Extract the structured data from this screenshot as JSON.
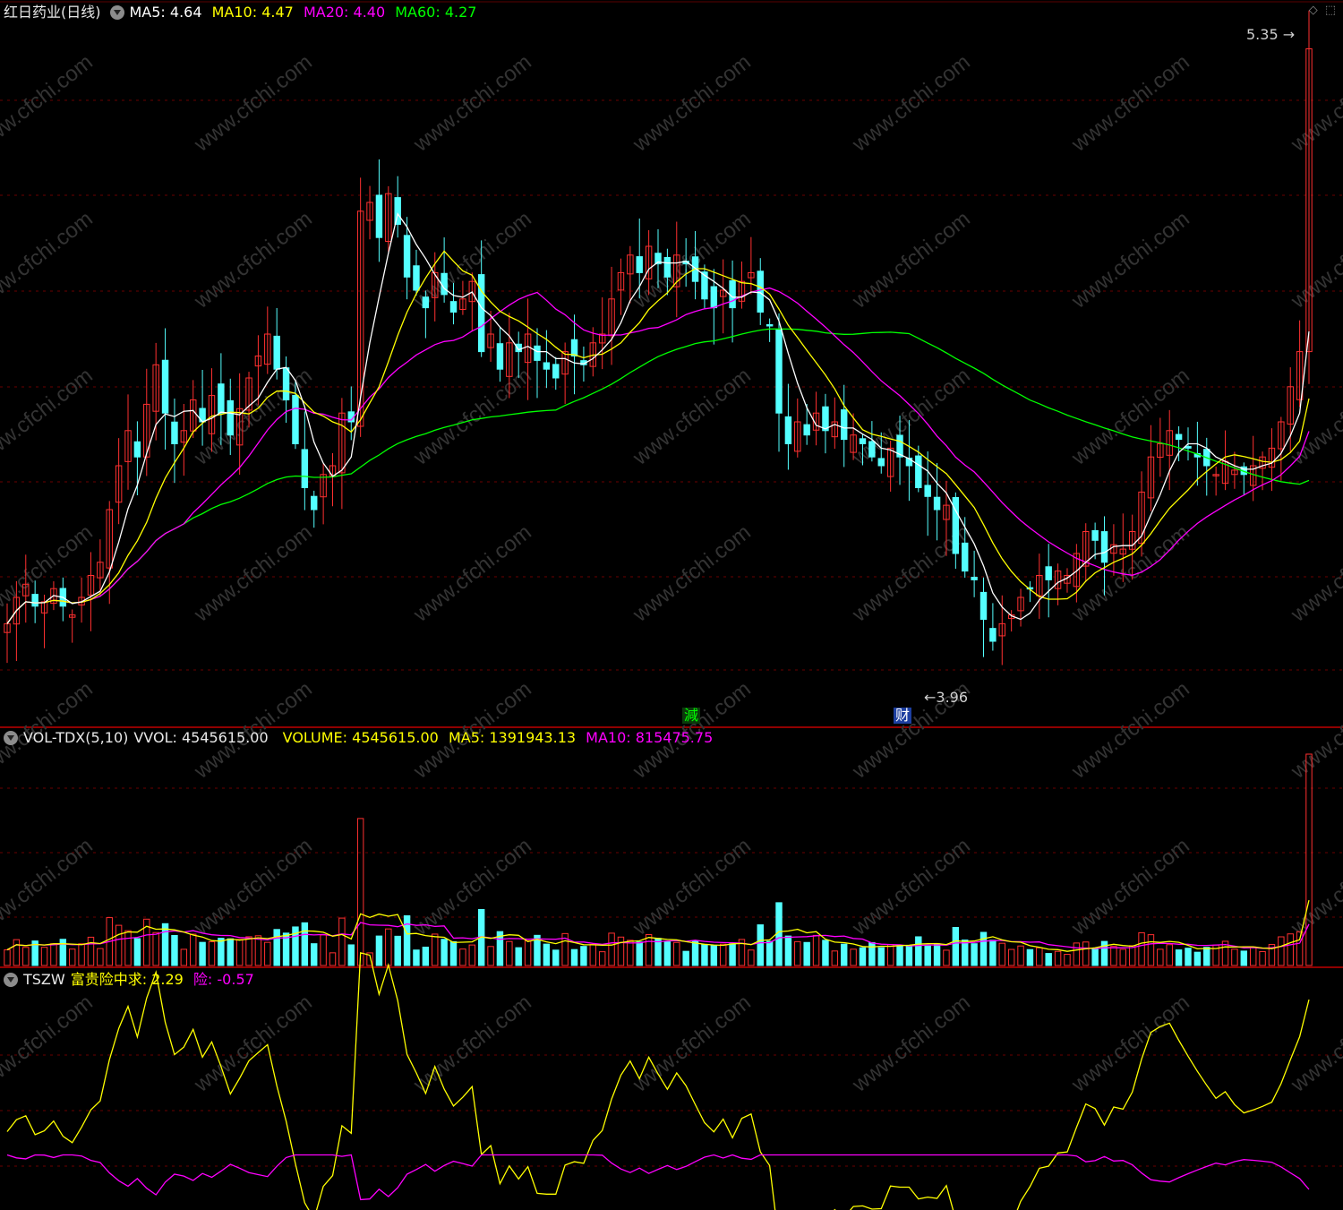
{
  "main_header": {
    "stock_title": "红日药业(日线)",
    "ma5": "MA5: 4.64",
    "ma10": "MA10: 4.47",
    "ma20": "MA20: 4.40",
    "ma60": "MA60: 4.27"
  },
  "vol_header": {
    "indicator": "VOL-TDX(5,10)",
    "vvol": "VVOL: 4545615.00",
    "volume": "VOLUME: 4545615.00",
    "ma5": "MA5: 1391943.13",
    "ma10": "MA10: 815475.75"
  },
  "tszw_header": {
    "indicator": "TSZW",
    "line1": "富贵险中求: 2.29",
    "line2": "险: -0.57"
  },
  "annotations": {
    "high_price": "5.35",
    "low_price": "3.96",
    "marker1": "減",
    "marker2": "财"
  },
  "watermark": "www.cfchi.com",
  "colors": {
    "up": "#ff3030",
    "down": "#54ffff",
    "ma5": "#ffffff",
    "ma10": "#ffff00",
    "ma20": "#ff00ff",
    "ma60": "#00ff00",
    "grid": "#6a0000",
    "divider": "#c00000"
  },
  "chart_data": {
    "type": "candlestick",
    "price_range": [
      3.9,
      5.4
    ],
    "close_series": [
      4.04,
      4.1,
      4.13,
      4.08,
      4.09,
      4.12,
      4.08,
      4.06,
      4.1,
      4.15,
      4.18,
      4.3,
      4.4,
      4.48,
      4.42,
      4.54,
      4.63,
      4.52,
      4.45,
      4.48,
      4.55,
      4.5,
      4.56,
      4.52,
      4.47,
      4.53,
      4.6,
      4.65,
      4.7,
      4.62,
      4.55,
      4.45,
      4.35,
      4.3,
      4.38,
      4.4,
      4.52,
      4.5,
      4.98,
      5.0,
      4.92,
      5.02,
      4.95,
      4.83,
      4.8,
      4.76,
      4.84,
      4.79,
      4.75,
      4.78,
      4.82,
      4.66,
      4.7,
      4.62,
      4.68,
      4.66,
      4.7,
      4.64,
      4.62,
      4.6,
      4.66,
      4.65,
      4.63,
      4.68,
      4.7,
      4.78,
      4.84,
      4.88,
      4.84,
      4.9,
      4.86,
      4.83,
      4.88,
      4.86,
      4.82,
      4.78,
      4.76,
      4.8,
      4.76,
      4.82,
      4.84,
      4.75,
      4.72,
      4.52,
      4.45,
      4.5,
      4.47,
      4.52,
      4.48,
      4.5,
      4.46,
      4.47,
      4.45,
      4.42,
      4.4,
      4.44,
      4.42,
      4.4,
      4.35,
      4.33,
      4.3,
      4.31,
      4.2,
      4.16,
      4.14,
      4.05,
      4.0,
      4.04,
      4.06,
      4.1,
      4.12,
      4.15,
      4.14,
      4.16,
      4.15,
      4.2,
      4.25,
      4.23,
      4.18,
      4.22,
      4.21,
      4.25,
      4.34,
      4.42,
      4.45,
      4.48,
      4.46,
      4.44,
      4.42,
      4.4,
      4.38,
      4.41,
      4.39,
      4.38,
      4.4,
      4.42,
      4.44,
      4.5,
      4.58,
      4.66,
      5.35
    ]
  }
}
